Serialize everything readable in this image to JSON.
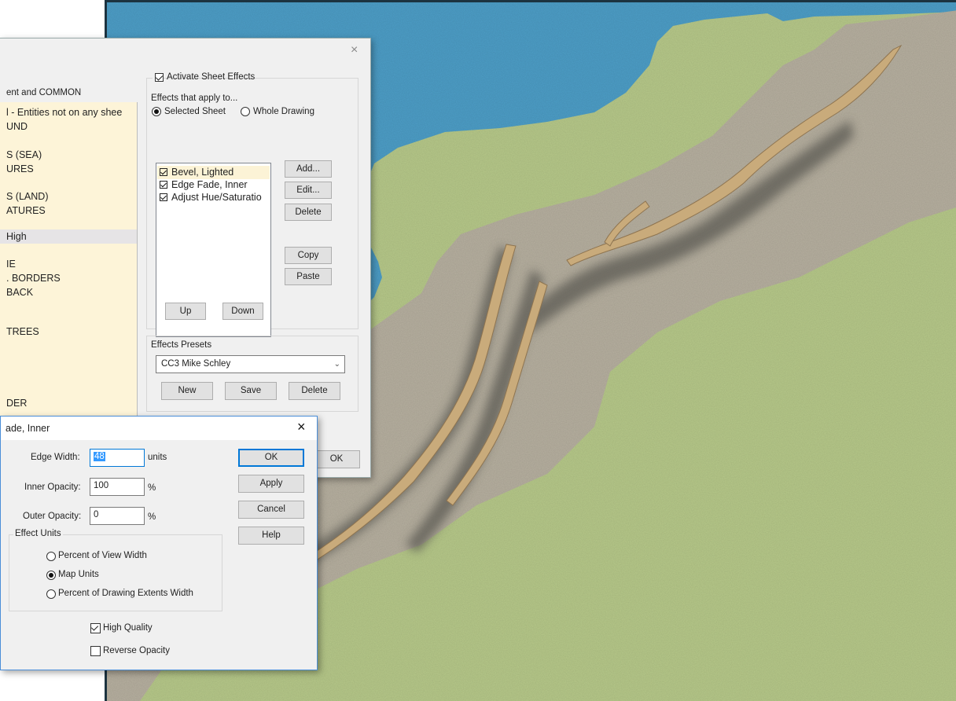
{
  "colors": {
    "land": "#b7c98a",
    "sea": "#4d9ec7",
    "road": "#b7b0a0",
    "cliff": "#c9ab7b",
    "shadow": "#5b5a52",
    "panel": "#f0f0f0",
    "sheetListBg": "#fdf4d8",
    "accent": "#0078d7"
  },
  "sheetDialog": {
    "close_icon": "×",
    "sheetListHeader": "ent and COMMON",
    "sheets": [
      "l - Entities not on any shee",
      "UND",
      "S (SEA)",
      "URES",
      "S (LAND)",
      "ATURES",
      "High",
      "IE",
      ". BORDERS",
      "BACK",
      "TREES",
      "DER"
    ],
    "selectedSheet": "High",
    "activate": {
      "label": "Activate Sheet Effects",
      "checked": true
    },
    "appliesTo": {
      "label": "Effects that apply to...",
      "options": [
        "Selected Sheet",
        "Whole Drawing"
      ],
      "selected": "Selected Sheet"
    },
    "effects": [
      {
        "label": "Bevel, Lighted",
        "checked": true
      },
      {
        "label": "Edge Fade, Inner",
        "checked": true
      },
      {
        "label": "Adjust Hue/Saturatio",
        "checked": true
      }
    ],
    "buttons": {
      "add": "Add...",
      "edit": "Edit...",
      "delete": "Delete",
      "copy": "Copy",
      "paste": "Paste",
      "up": "Up",
      "down": "Down",
      "ok": "OK"
    },
    "presets": {
      "label": "Effects Presets",
      "selected": "CC3 Mike Schley",
      "new": "New",
      "save": "Save",
      "delete": "Delete"
    }
  },
  "fadeDialog": {
    "title": "ade, Inner",
    "close_icon": "×",
    "edgeWidth": {
      "label": "Edge Width:",
      "value": "48",
      "unit": "units"
    },
    "innerOpacity": {
      "label": "Inner Opacity:",
      "value": "100",
      "unit": "%"
    },
    "outerOpacity": {
      "label": "Outer Opacity:",
      "value": "0",
      "unit": "%"
    },
    "effectUnits": {
      "label": "Effect Units",
      "options": [
        "Percent of View Width",
        "Map Units",
        "Percent of Drawing Extents Width"
      ],
      "selected": "Map Units"
    },
    "highQuality": {
      "label": "High Quality",
      "checked": true
    },
    "reverseOpacity": {
      "label": "Reverse Opacity",
      "checked": false
    },
    "buttons": {
      "ok": "OK",
      "apply": "Apply",
      "cancel": "Cancel",
      "help": "Help"
    }
  }
}
